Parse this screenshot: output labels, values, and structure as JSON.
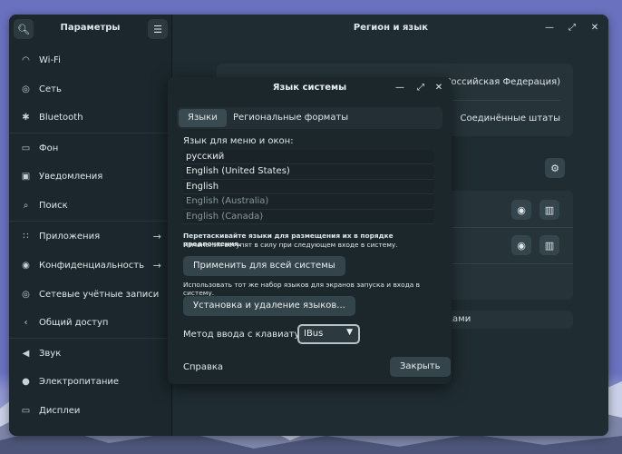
{
  "sidebar": {
    "title": "Параметры",
    "search_icon": "search-icon",
    "menu_icon": "hamburger-icon",
    "items": [
      {
        "label": "Wi-Fi",
        "icon": "wifi-icon"
      },
      {
        "label": "Сеть",
        "icon": "network-icon"
      },
      {
        "label": "Bluetooth",
        "icon": "bluetooth-icon"
      },
      {
        "label": "Фон",
        "icon": "background-icon"
      },
      {
        "label": "Уведомления",
        "icon": "bell-icon"
      },
      {
        "label": "Поиск",
        "icon": "search-icon"
      },
      {
        "label": "Приложения",
        "icon": "apps-grid-icon"
      },
      {
        "label": "Конфиденциальность",
        "icon": "privacy-icon"
      },
      {
        "label": "Сетевые учётные записи",
        "icon": "online-accounts-icon"
      },
      {
        "label": "Общий доступ",
        "icon": "share-icon"
      },
      {
        "label": "Звук",
        "icon": "sound-icon"
      },
      {
        "label": "Электропитание",
        "icon": "power-icon"
      },
      {
        "label": "Дисплеи",
        "icon": "display-icon"
      }
    ]
  },
  "main": {
    "title": "Регион и язык",
    "region_text": "(Российская Федерация)",
    "formats_text": "Соединённые штаты",
    "bottom_text": "ками"
  },
  "dialog": {
    "title": "Язык системы",
    "tabs": [
      "Языки",
      "Региональные форматы"
    ],
    "list_label": "Язык для меню и окон:",
    "languages": [
      "русский",
      "English (United States)",
      "English",
      "English (Australia)",
      "English (Canada)"
    ],
    "hint_bold": "Перетаскивайте языки для размещения их в порядке предпочтения.",
    "hint_next_login": "Изменения вступят в силу при следующем входе в систему.",
    "apply_button": "Применить для всей системы",
    "apply_hint": "Использовать тот же набор языков для экранов запуска и входа в систему.",
    "install_button": "Установка и удаление языков...",
    "keyboard_label": "Метод ввода с клавиатуры:",
    "keyboard_value": "IBus",
    "help_link": "Справка",
    "close_button": "Закрыть"
  }
}
